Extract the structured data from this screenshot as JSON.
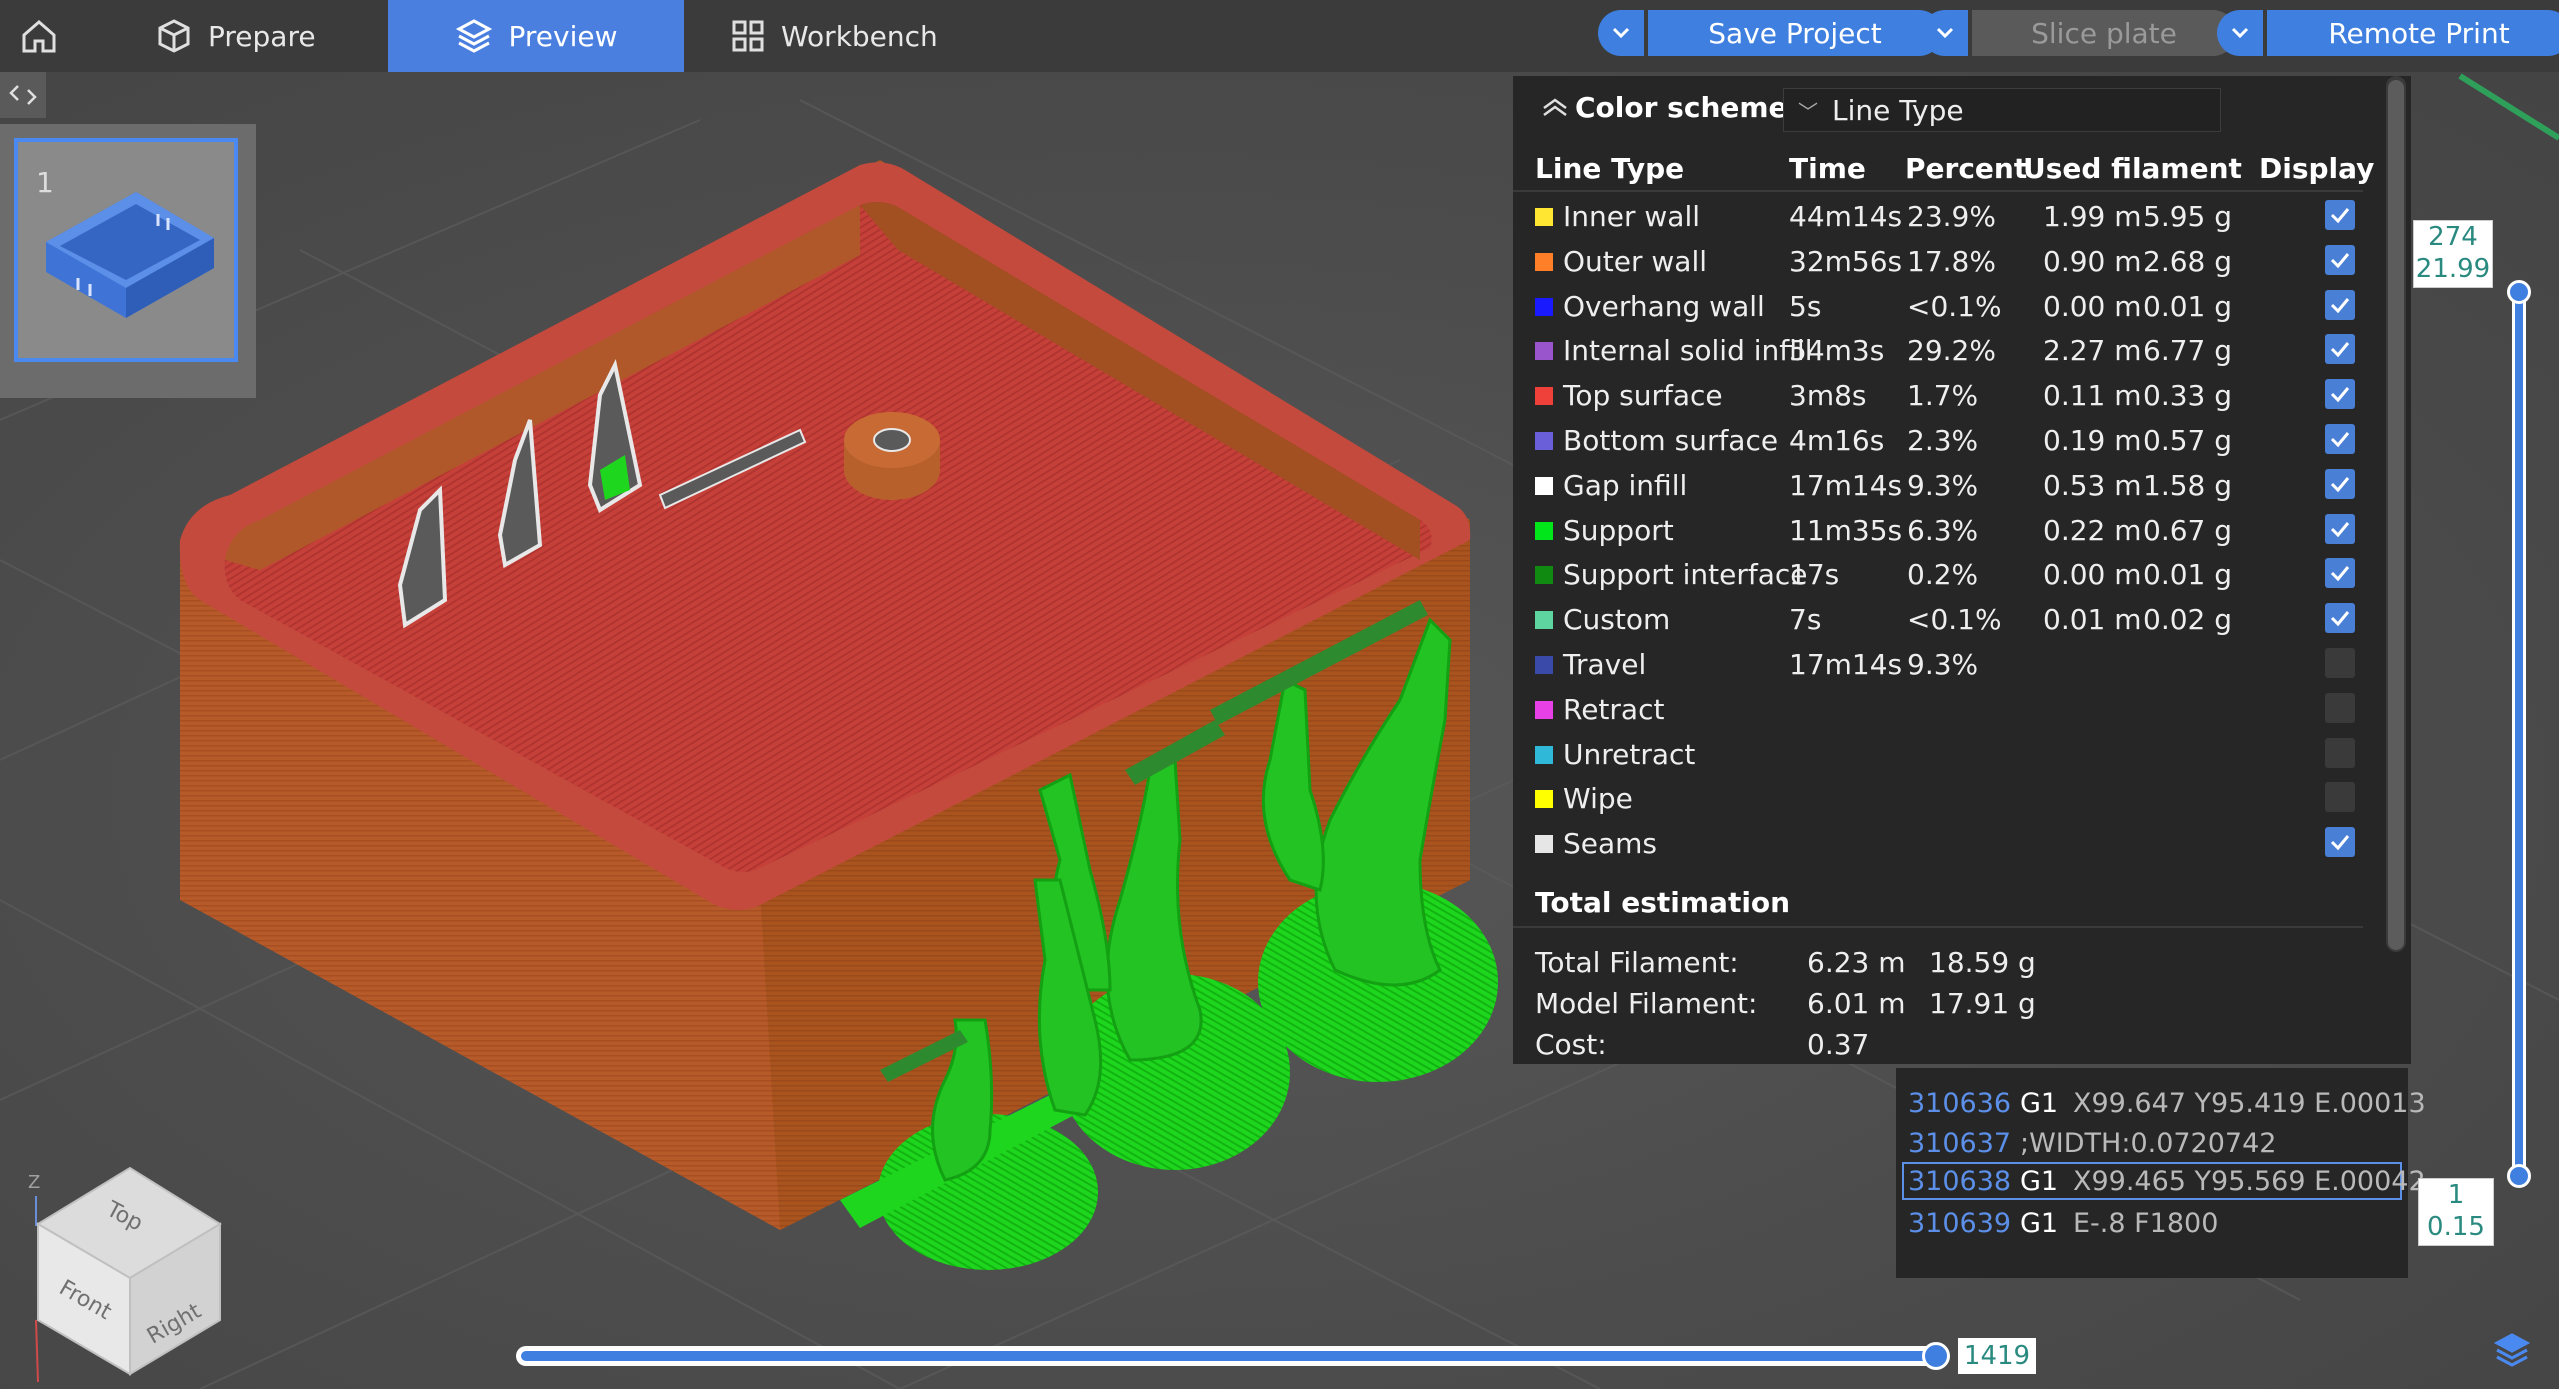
{
  "topbar": {
    "tabs": [
      {
        "label": "Prepare",
        "icon": "cube-icon"
      },
      {
        "label": "Preview",
        "icon": "layers-icon",
        "active": true
      },
      {
        "label": "Workbench",
        "icon": "grid-icon"
      }
    ],
    "actions": [
      {
        "label": "Save Project",
        "enabled": true
      },
      {
        "label": "Slice plate",
        "enabled": false
      },
      {
        "label": "Remote Print",
        "enabled": true
      }
    ],
    "accent_color": "#3e7fe0"
  },
  "plate_list": {
    "plates": [
      {
        "number": "1",
        "selected": true
      }
    ]
  },
  "legend": {
    "title": "Color scheme",
    "scheme": "Line Type",
    "columns": {
      "line_type": "Line Type",
      "time": "Time",
      "percent": "Percent",
      "used_filament": "Used filament",
      "display": "Display"
    },
    "rows": [
      {
        "name": "Inner wall",
        "color": "#ffe632",
        "time": "44m14s",
        "percent": "23.9%",
        "length": "1.99 m",
        "weight": "5.95 g",
        "display": true
      },
      {
        "name": "Outer wall",
        "color": "#ff7f29",
        "time": "32m56s",
        "percent": "17.8%",
        "length": "0.90 m",
        "weight": "2.68 g",
        "display": true
      },
      {
        "name": "Overhang wall",
        "color": "#1a1aff",
        "time": "5s",
        "percent": "<0.1%",
        "length": "0.00 m",
        "weight": "0.01 g",
        "display": true
      },
      {
        "name": "Internal solid infill",
        "color": "#9955cc",
        "time": "54m3s",
        "percent": "29.2%",
        "length": "2.27 m",
        "weight": "6.77 g",
        "display": true
      },
      {
        "name": "Top surface",
        "color": "#f0403a",
        "time": "3m8s",
        "percent": "1.7%",
        "length": "0.11 m",
        "weight": "0.33 g",
        "display": true
      },
      {
        "name": "Bottom surface",
        "color": "#6a5fd8",
        "time": "4m16s",
        "percent": "2.3%",
        "length": "0.19 m",
        "weight": "0.57 g",
        "display": true
      },
      {
        "name": "Gap infill",
        "color": "#ffffff",
        "time": "17m14s",
        "percent": "9.3%",
        "length": "0.53 m",
        "weight": "1.58 g",
        "display": true
      },
      {
        "name": "Support",
        "color": "#00e61a",
        "time": "11m35s",
        "percent": "6.3%",
        "length": "0.22 m",
        "weight": "0.67 g",
        "display": true
      },
      {
        "name": "Support interface",
        "color": "#118a11",
        "time": "17s",
        "percent": "0.2%",
        "length": "0.00 m",
        "weight": "0.01 g",
        "display": true
      },
      {
        "name": "Custom",
        "color": "#5ed5a0",
        "time": "7s",
        "percent": "<0.1%",
        "length": "0.01 m",
        "weight": "0.02 g",
        "display": true
      },
      {
        "name": "Travel",
        "color": "#3a4aa8",
        "time": "17m14s",
        "percent": "9.3%",
        "length": "",
        "weight": "",
        "display": false
      },
      {
        "name": "Retract",
        "color": "#e640e6",
        "time": "",
        "percent": "",
        "length": "",
        "weight": "",
        "display": false
      },
      {
        "name": "Unretract",
        "color": "#30b8d8",
        "time": "",
        "percent": "",
        "length": "",
        "weight": "",
        "display": false
      },
      {
        "name": "Wipe",
        "color": "#ffff00",
        "time": "",
        "percent": "",
        "length": "",
        "weight": "",
        "display": false
      },
      {
        "name": "Seams",
        "color": "#e6e6e6",
        "time": "",
        "percent": "",
        "length": "",
        "weight": "",
        "display": true
      }
    ],
    "total": {
      "title": "Total estimation",
      "rows": [
        {
          "label": "Total Filament:",
          "length": "6.23 m",
          "weight": "18.59 g"
        },
        {
          "label": "Model Filament:",
          "length": "6.01 m",
          "weight": "17.91 g"
        },
        {
          "label": "Cost:",
          "length": "0.37",
          "weight": ""
        }
      ]
    }
  },
  "gcode": {
    "lines": [
      {
        "num": "310636",
        "cmd": "G1",
        "args": "X99.647 Y95.419 E.00013",
        "selected": false
      },
      {
        "num": "310637",
        "cmd": "",
        "args": ";WIDTH:0.0720742",
        "selected": false
      },
      {
        "num": "310638",
        "cmd": "G1",
        "args": "X99.465 Y95.569 E.00042",
        "selected": true
      },
      {
        "num": "310639",
        "cmd": "G1",
        "args": "E-.8 F1800",
        "selected": false
      }
    ]
  },
  "layer_slider": {
    "top_layer": "274",
    "top_height": "21.99",
    "bottom_layer": "1",
    "bottom_height": "0.15"
  },
  "move_slider": {
    "value": "1419"
  },
  "viewcube": {
    "top": "Top",
    "front": "Front",
    "right": "Right",
    "z_axis": "Z"
  }
}
